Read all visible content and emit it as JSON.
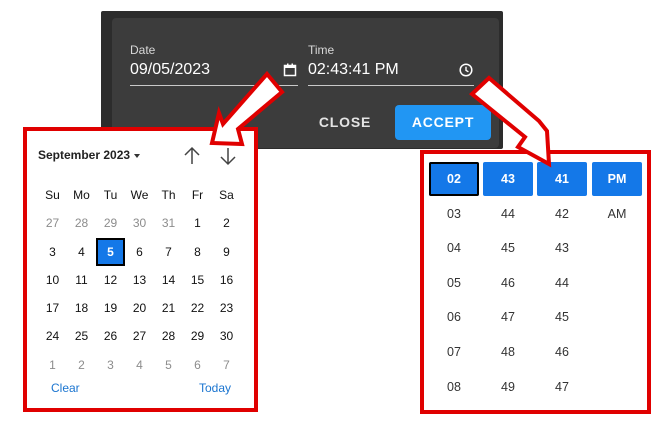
{
  "dialog": {
    "date_label": "Date",
    "date_value": "09/05/2023",
    "time_label": "Time",
    "time_value": "02:43:41 PM",
    "close_label": "CLOSE",
    "accept_label": "ACCEPT",
    "accent_color": "#2196f3"
  },
  "calendar": {
    "month_label": "September 2023",
    "weekdays": [
      "Su",
      "Mo",
      "Tu",
      "We",
      "Th",
      "Fr",
      "Sa"
    ],
    "weeks": [
      [
        "27",
        "28",
        "29",
        "30",
        "31",
        "1",
        "2"
      ],
      [
        "3",
        "4",
        "5",
        "6",
        "7",
        "8",
        "9"
      ],
      [
        "10",
        "11",
        "12",
        "13",
        "14",
        "15",
        "16"
      ],
      [
        "17",
        "18",
        "19",
        "20",
        "21",
        "22",
        "23"
      ],
      [
        "24",
        "25",
        "26",
        "27",
        "28",
        "29",
        "30"
      ],
      [
        "1",
        "2",
        "3",
        "4",
        "5",
        "6",
        "7"
      ]
    ],
    "selected_day": "5",
    "clear_label": "Clear",
    "today_label": "Today"
  },
  "time_picker": {
    "hours": [
      "02",
      "03",
      "04",
      "05",
      "06",
      "07",
      "08"
    ],
    "minutes": [
      "43",
      "44",
      "45",
      "46",
      "47",
      "48",
      "49"
    ],
    "seconds": [
      "41",
      "42",
      "43",
      "44",
      "45",
      "46",
      "47"
    ],
    "meridiem": [
      "PM",
      "AM"
    ]
  },
  "icons": {
    "date_field": "calendar-icon",
    "time_field": "clock-icon",
    "nav_prev": "arrow-up-icon",
    "nav_next": "arrow-down-icon",
    "month_dropdown": "caret-down-icon"
  },
  "annotation_color": "#e00000"
}
